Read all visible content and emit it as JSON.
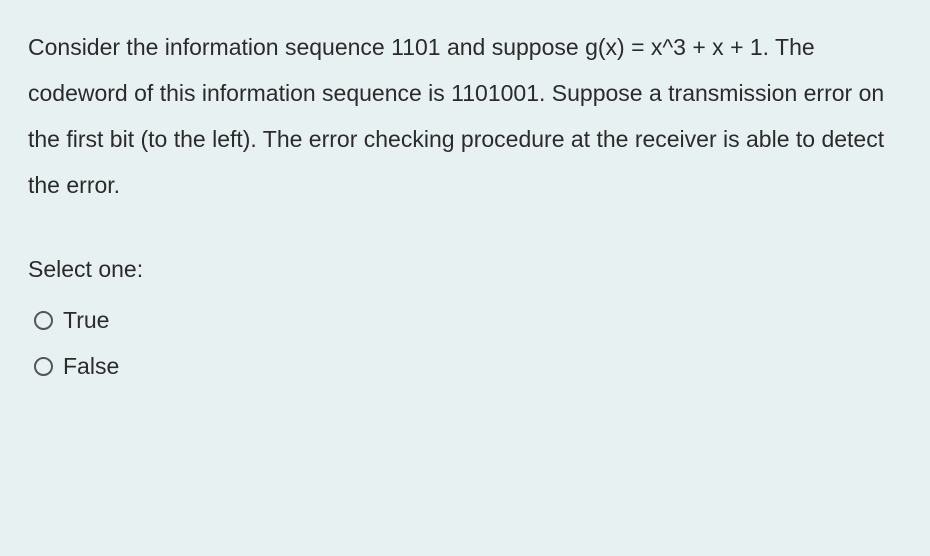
{
  "question": {
    "text": "Consider the information sequence 1101 and suppose g(x) = x^3 + x + 1. The codeword of this information sequence is 1101001. Suppose a transmission error on the first bit (to the left). The error checking procedure at the receiver is able to detect the error."
  },
  "prompt": "Select one:",
  "options": [
    {
      "label": "True",
      "selected": false
    },
    {
      "label": "False",
      "selected": false
    }
  ]
}
